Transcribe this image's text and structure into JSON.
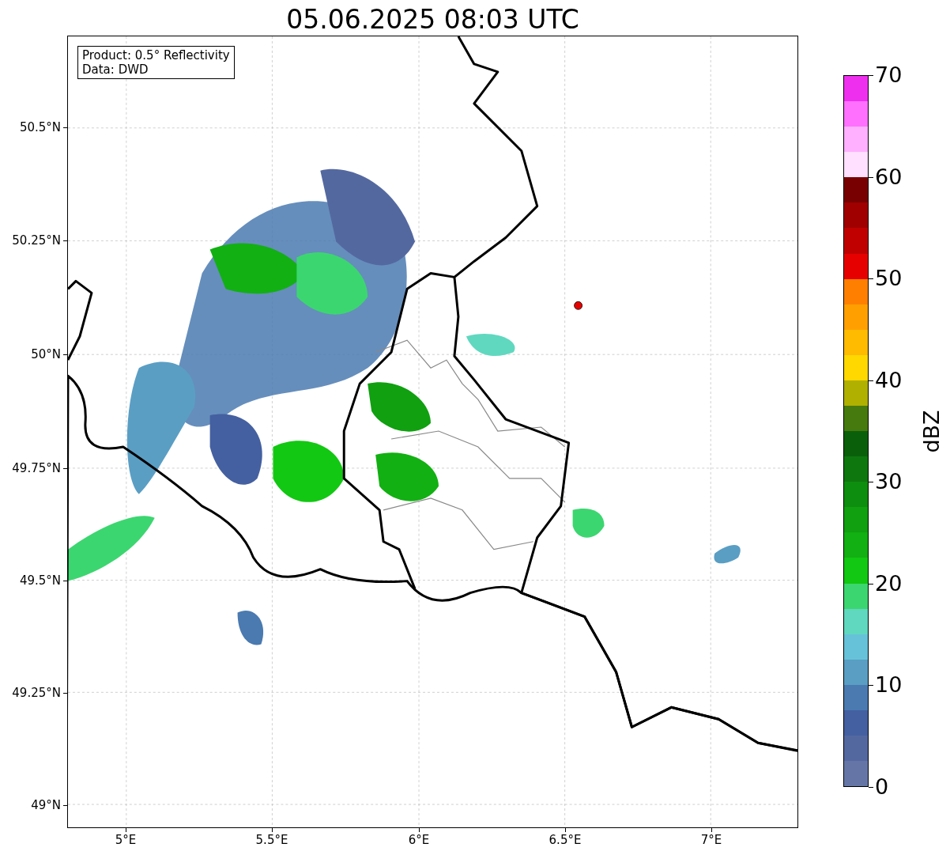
{
  "title": "05.06.2025 08:03 UTC",
  "legend": [
    "Product: 0.5° Reflectivity",
    "Data: DWD"
  ],
  "axes": {
    "y_labels": [
      "50.5°N",
      "50.25°N",
      "50°N",
      "49.75°N",
      "49.5°N",
      "49.25°N",
      "49°N"
    ],
    "x_labels": [
      "5°E",
      "5.5°E",
      "6°E",
      "6.5°E",
      "7°E"
    ]
  },
  "colorbar": {
    "label": "dBZ",
    "ticks": [
      "70",
      "60",
      "50",
      "40",
      "30",
      "20",
      "10",
      "0"
    ],
    "segments": [
      {
        "color": "#6576a6"
      },
      {
        "color": "#5468a0"
      },
      {
        "color": "#4460a0"
      },
      {
        "color": "#4a7ab0"
      },
      {
        "color": "#5a9ec4"
      },
      {
        "color": "#66c2d8"
      },
      {
        "color": "#60d8c0"
      },
      {
        "color": "#3cd670"
      },
      {
        "color": "#12c812"
      },
      {
        "color": "#12b012"
      },
      {
        "color": "#10a010"
      },
      {
        "color": "#0e8e0e"
      },
      {
        "color": "#0e780e"
      },
      {
        "color": "#0a600a"
      },
      {
        "color": "#467a0e"
      },
      {
        "color": "#b0b000"
      },
      {
        "color": "#ffd800"
      },
      {
        "color": "#ffbb00"
      },
      {
        "color": "#ffa000"
      },
      {
        "color": "#ff8000"
      },
      {
        "color": "#e60000"
      },
      {
        "color": "#c00000"
      },
      {
        "color": "#a00000"
      },
      {
        "color": "#780000"
      },
      {
        "color": "#ffe0ff"
      },
      {
        "color": "#ffb0ff"
      },
      {
        "color": "#ff70ff"
      },
      {
        "color": "#ee30ee"
      }
    ]
  }
}
